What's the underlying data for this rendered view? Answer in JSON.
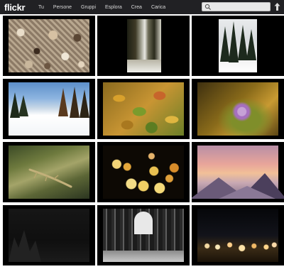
{
  "header": {
    "logo": "flickr",
    "nav": [
      "Tu",
      "Persone",
      "Gruppi",
      "Esplora",
      "Crea",
      "Carica"
    ],
    "search": {
      "value": "",
      "placeholder": ""
    }
  },
  "colors": {
    "topbar": "#212124",
    "tile_background": "#000000",
    "page_background": "#ffffff"
  },
  "icons": [
    "search-icon",
    "upload-icon"
  ],
  "photos": [
    {
      "subject": "shells",
      "caption": ""
    },
    {
      "subject": "forest-stream",
      "caption": ""
    },
    {
      "subject": "snowy-pines",
      "caption": ""
    },
    {
      "subject": "winter-landscape",
      "caption": ""
    },
    {
      "subject": "autumn-leaves",
      "caption": ""
    },
    {
      "subject": "purple-thistle",
      "caption": ""
    },
    {
      "subject": "lizard-in-stream",
      "caption": ""
    },
    {
      "subject": "bokeh-lights",
      "caption": ""
    },
    {
      "subject": "misty-mountains",
      "caption": ""
    },
    {
      "subject": "dark-forest",
      "caption": ""
    },
    {
      "subject": "abbey-ruins",
      "caption": ""
    },
    {
      "subject": "night-city-lights",
      "caption": ""
    }
  ]
}
